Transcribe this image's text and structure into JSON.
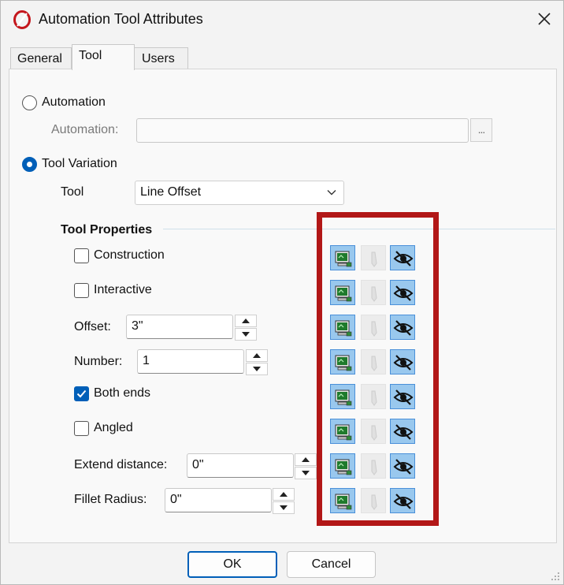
{
  "window": {
    "title": "Automation Tool Attributes"
  },
  "tabs": [
    {
      "label": "General",
      "active": false
    },
    {
      "label": "Tool",
      "active": true
    },
    {
      "label": "Users",
      "active": false
    }
  ],
  "automation": {
    "radio_label": "Automation",
    "selected": false,
    "field_label": "Automation:",
    "field_value": "",
    "browse_label": "..."
  },
  "tool_variation": {
    "radio_label": "Tool Variation",
    "selected": true,
    "tool_label": "Tool",
    "tool_value": "Line Offset"
  },
  "tool_properties": {
    "group_label": "Tool Properties",
    "construction": {
      "label": "Construction",
      "checked": false
    },
    "interactive": {
      "label": "Interactive",
      "checked": false
    },
    "offset": {
      "label": "Offset:",
      "value": "3\""
    },
    "number": {
      "label": "Number:",
      "value": "1"
    },
    "both_ends": {
      "label": "Both ends",
      "checked": true
    },
    "angled": {
      "label": "Angled",
      "checked": false
    },
    "extend_distance": {
      "label": "Extend distance:",
      "value": "0\""
    },
    "fillet_radius": {
      "label": "Fillet Radius:",
      "value": "0\""
    }
  },
  "property_icons": {
    "columns": [
      "display-in-dialog-icon",
      "pencil-icon",
      "hidden-eye-icon"
    ],
    "rows": 8
  },
  "buttons": {
    "ok": "OK",
    "cancel": "Cancel"
  },
  "colors": {
    "accent": "#005fb8",
    "highlight_border": "#b21717",
    "icon_active_bg": "#99c8ee"
  }
}
